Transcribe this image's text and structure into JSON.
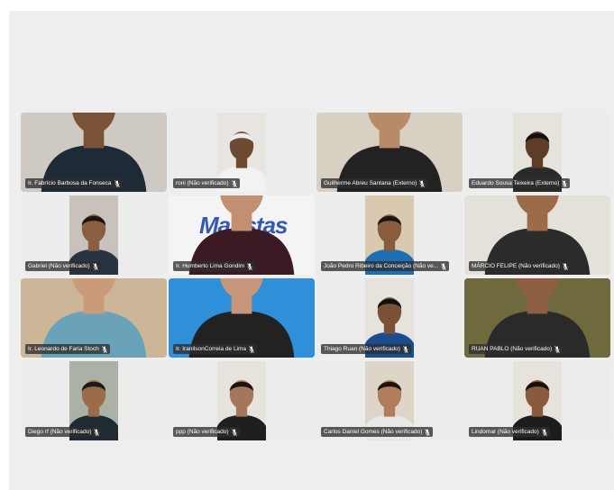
{
  "meeting": {
    "participants": [
      {
        "name": "Ir. Fabrício Barbosa da Fonseca",
        "mic_icon": "mic-muted-icon",
        "bg": "#cfc9c4",
        "video": "full",
        "skin": "#7a5236",
        "shirt": "#1e2a35",
        "hair": "#2a1c14"
      },
      {
        "name": "roni (Não verificado)",
        "mic_icon": "mic-muted-icon",
        "bg": "#e8e4e0",
        "video": "narrow",
        "skin": "#6e4a33",
        "shirt": "#f2f2f2",
        "hair": "#ededed"
      },
      {
        "name": "Guilherme Abreu Santana (Externo)",
        "mic_icon": "mic-muted-icon",
        "bg": "#d8d0c2",
        "video": "full",
        "skin": "#b98a6a",
        "shirt": "#222222",
        "hair": "#1c1410"
      },
      {
        "name": "Eduardo Sousa Teixeira (Externo)",
        "mic_icon": "mic-muted-icon",
        "bg": "#e6e2dc",
        "video": "narrow",
        "skin": "#5e3d28",
        "shirt": "#2a2a2a",
        "hair": "#151010"
      },
      {
        "name": "Gabriel (Não verificado)",
        "mic_icon": "mic-muted-icon",
        "bg": "#c8c2ba",
        "video": "narrow",
        "skin": "#8a5e40",
        "shirt": "#2a3340",
        "hair": "#1a1410"
      },
      {
        "name": "Ir. Humberto Lima Gondim",
        "mic_icon": "mic-muted-icon",
        "bg": "#f4f4f6",
        "video": "full",
        "skin": "#c29070",
        "shirt": "#3b1a24",
        "hair": "#222222",
        "overlay_text": "Maristas"
      },
      {
        "name": "João Pedro Ribeiro da Conceição (Não ve...",
        "mic_icon": "mic-muted-icon",
        "bg": "#d9c9b0",
        "video": "narrow",
        "skin": "#8a5c3e",
        "shirt": "#1f6fb3",
        "hair": "#1b1410"
      },
      {
        "name": "MÁRCIO FELIPE (Não verificado)",
        "mic_icon": "mic-muted-icon",
        "bg": "#e4e0da",
        "video": "full",
        "skin": "#9c6b4a",
        "shirt": "#2b2b2b",
        "hair": "#1a1410"
      },
      {
        "name": "Ir. Leonardo de Faria Stoch",
        "mic_icon": "mic-muted-icon",
        "bg": "#cdb597",
        "video": "full",
        "skin": "#c99b78",
        "shirt": "#6aa2b8",
        "hair": "#3b2a1e"
      },
      {
        "name": "Ir. IranilsonCorreia de Lima",
        "mic_icon": "mic-muted-icon",
        "bg": "#2f8fd8",
        "video": "full",
        "skin": "#c7957a",
        "shirt": "#222222",
        "hair": "#333333"
      },
      {
        "name": "Thiago Ruan (Não verificado)",
        "mic_icon": "mic-muted-icon",
        "bg": "#e6e2dc",
        "video": "narrow",
        "skin": "#7a5036",
        "shirt": "#1b4d8c",
        "hair": "#151010"
      },
      {
        "name": "RUAN PABLO (Não verificado)",
        "mic_icon": "mic-muted-icon",
        "bg": "#6e6a3e",
        "video": "full",
        "skin": "#8e5e42",
        "shirt": "#2a2a2a",
        "hair": "#1a1410"
      },
      {
        "name": "Diego rf (Não verificado)",
        "mic_icon": "mic-muted-icon",
        "bg": "#aab2a6",
        "video": "narrow",
        "skin": "#9a6c4a",
        "shirt": "#1f2a33",
        "hair": "#1a1a1a"
      },
      {
        "name": "ppp (Não verificado)",
        "mic_icon": "mic-muted-icon",
        "bg": "#e6e2dc",
        "video": "narrow",
        "skin": "#a5765a",
        "shirt": "#1f1f1f",
        "hair": "#1a1410"
      },
      {
        "name": "Carlos Daniel Gomes (Não verificado)",
        "mic_icon": "mic-muted-icon",
        "bg": "#ddd6c8",
        "video": "narrow",
        "skin": "#b07e5c",
        "shirt": "#e8e8e8",
        "hair": "#1a1410"
      },
      {
        "name": "Lindomar (Não verificado)",
        "mic_icon": "mic-muted-icon",
        "bg": "#e6e2dc",
        "video": "narrow",
        "skin": "#8a5a3c",
        "shirt": "#1c1c1c",
        "hair": "#151010"
      }
    ]
  }
}
